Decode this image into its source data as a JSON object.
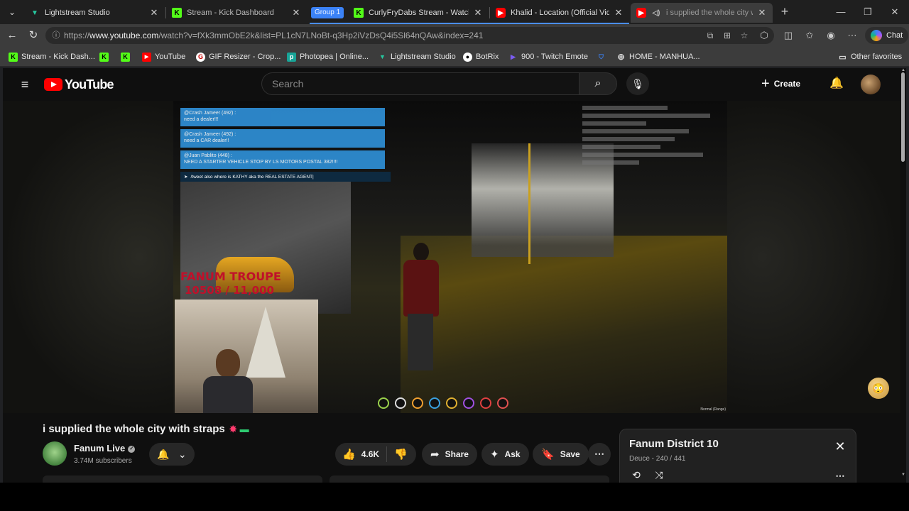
{
  "browser": {
    "tabs": [
      {
        "label": "Lightstream Studio",
        "favicon": "lightstream-icon"
      },
      {
        "label": "Stream - Kick Dashboard",
        "favicon": "kick-icon"
      },
      {
        "label": "CurlyFryDabs Stream - Watch Live",
        "favicon": "kick-icon"
      },
      {
        "label": "Khalid - Location (Official Video) -",
        "favicon": "youtube-icon"
      },
      {
        "label": "i supplied the whole city with",
        "favicon": "youtube-icon",
        "active": true
      }
    ],
    "group_label": "Group 1",
    "url_prefix": "https://",
    "url_host": "www.youtube.com",
    "url_path": "/watch?v=fXk3mmObE2k&list=PL1cN7LNoBt-q3Hp2iVzDsQ4i5Sl64nQAw&index=241",
    "chat_label": "Chat",
    "bookmarks": [
      {
        "label": "Stream - Kick Dash...",
        "icon": "kick-icon"
      },
      {
        "label": "",
        "icon": "kick-icon"
      },
      {
        "label": "",
        "icon": "kick-icon"
      },
      {
        "label": "YouTube",
        "icon": "youtube-icon"
      },
      {
        "label": "GIF Resizer - Crop...",
        "icon": "gif-icon"
      },
      {
        "label": "Photopea | Online...",
        "icon": "photopea-icon"
      },
      {
        "label": "Lightstream Studio",
        "icon": "lightstream-icon"
      },
      {
        "label": "BotRix",
        "icon": "botrix-icon"
      },
      {
        "label": "900 - Twitch Emote",
        "icon": "twitch-icon"
      },
      {
        "label": "",
        "icon": "shield-icon"
      },
      {
        "label": "HOME - MANHUA...",
        "icon": "globe-icon"
      }
    ],
    "other_favorites": "Other favorites"
  },
  "youtube": {
    "logo_text": "YouTube",
    "search_placeholder": "Search",
    "create_label": "Create",
    "video": {
      "chat_messages": [
        {
          "user": "@Crash Jameer (492) :",
          "text": "need a dealer!!!"
        },
        {
          "user": "@Crash Jameer (492) :",
          "text": "need a CAR dealer!!"
        },
        {
          "user": "@Juan Pablito (448) :",
          "text": "NEED A STARTER VEHICLE STOP BY LS MOTORS POSTAL 382!!!!"
        }
      ],
      "chat_input": "/tweet also where is KATHY aka the REAL ESTATE AGENT|",
      "overlay_title": "FANUM TROUPE",
      "overlay_count": "10508 / 11,000",
      "mode_text": "Normal (Range)"
    },
    "title": "i supplied the whole city with straps",
    "channel": {
      "name": "Fanum Live",
      "subscribers": "3.74M subscribers"
    },
    "actions": {
      "likes": "4.6K",
      "share": "Share",
      "ask": "Ask",
      "save": "Save"
    },
    "playlist": {
      "title": "Fanum District 10",
      "subtitle": "Deuce - 240 / 441"
    }
  }
}
